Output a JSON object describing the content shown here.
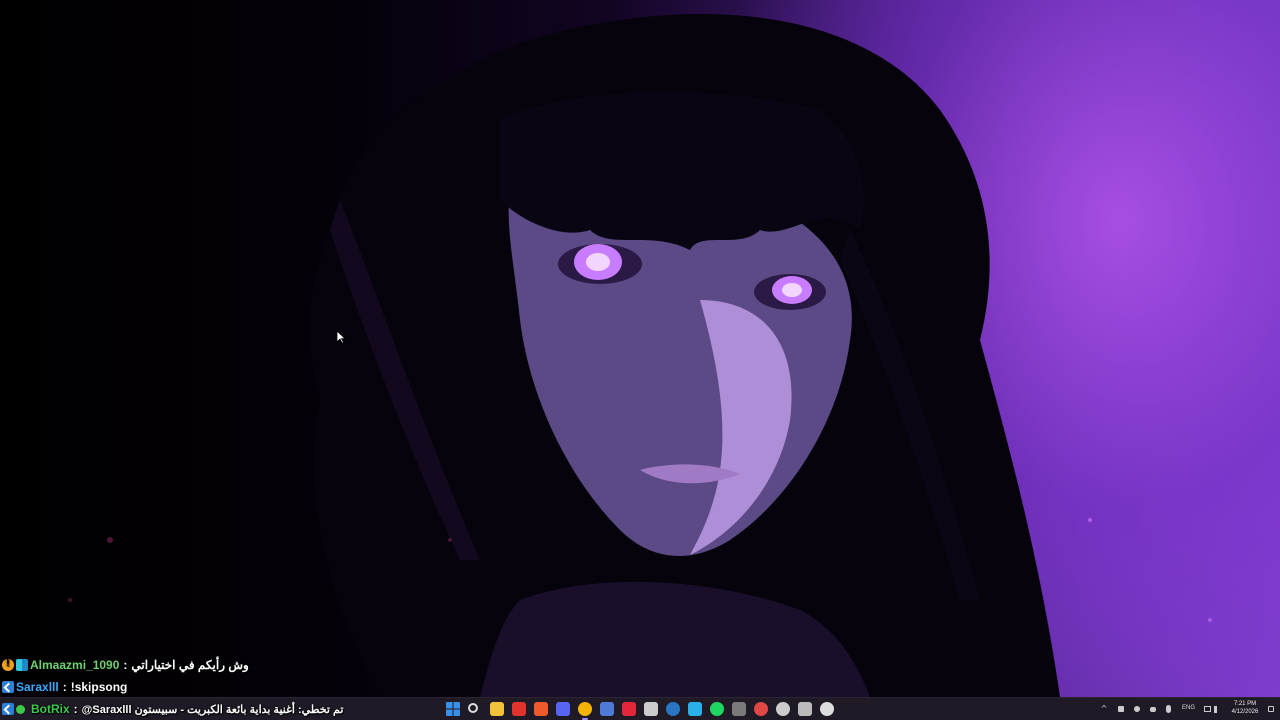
{
  "chat": {
    "messages": [
      {
        "badges": [
          "gold-badge",
          "grid-badge"
        ],
        "username": "Almaazmi_1090",
        "separator": ":",
        "text": "وش رأيكم في اختياراتي",
        "username_color": "#6fd06f"
      },
      {
        "badges": [
          "bot-badge"
        ],
        "username": "Saraxlll",
        "separator": ":",
        "text": "!skipsong",
        "username_color": "#3aa8ff"
      },
      {
        "badges": [
          "bot-badge",
          "online-badge"
        ],
        "username": "BotRix",
        "separator": ":",
        "text": "@Saraxlll تم تخطي: أغنية بداية بائعة الكبريت - سبيستون",
        "username_color": "#3cc94a"
      }
    ]
  },
  "taskbar": {
    "icons": [
      {
        "name": "windows-start-icon",
        "color": "#3a8fe8"
      },
      {
        "name": "search-icon",
        "color": "#dddddd"
      },
      {
        "name": "file-explorer-icon",
        "color": "#f2c23a"
      },
      {
        "name": "screen-recorder-icon",
        "color": "#e0342c"
      },
      {
        "name": "brave-browser-icon",
        "color": "#f0592b"
      },
      {
        "name": "discord-icon",
        "color": "#5865f2"
      },
      {
        "name": "chrome-icon",
        "color": "#f5b400"
      },
      {
        "name": "vpn-icon",
        "color": "#4f7bd8"
      },
      {
        "name": "adobe-icon",
        "color": "#e3263a"
      },
      {
        "name": "app-grid-icon",
        "color": "#cccccc"
      },
      {
        "name": "steam-icon",
        "color": "#2a75c4"
      },
      {
        "name": "photos-icon",
        "color": "#2ab0e8"
      },
      {
        "name": "spotify-icon",
        "color": "#1ed760"
      },
      {
        "name": "xbox-icon",
        "color": "#7a7a7a"
      },
      {
        "name": "game-launcher-icon",
        "color": "#e04848"
      },
      {
        "name": "back-arrow-icon",
        "color": "#cccccc"
      },
      {
        "name": "keyboard-icon",
        "color": "#bbbbbb"
      },
      {
        "name": "obs-icon",
        "color": "#dddddd"
      }
    ],
    "active_icon": "chrome-icon",
    "tray": {
      "chevron": "^",
      "language": "ENG",
      "time": "7:21 PM",
      "date": "4/12/2026"
    }
  }
}
